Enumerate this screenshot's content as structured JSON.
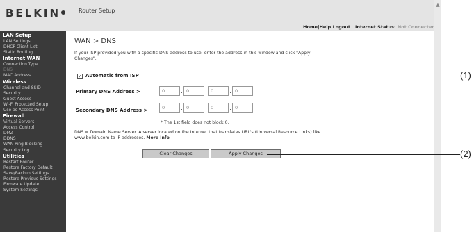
{
  "header": {
    "logo": "BELKIN",
    "app_title": "Router Setup",
    "links": [
      "Home",
      "Help",
      "Logout"
    ],
    "status_label": "Internet Status:",
    "status_value": "Not Connected"
  },
  "sidebar": [
    {
      "title": "LAN Setup",
      "items": [
        "LAN Settings",
        "DHCP Client List",
        "Static Routing"
      ]
    },
    {
      "title": "Internet WAN",
      "items": [
        "Connection Type",
        "DNS",
        "MAC Address"
      ]
    },
    {
      "title": "Wireless",
      "items": [
        "Channel and SSID",
        "Security",
        "Guest Access",
        "Wi-Fi Protected Setup",
        "Use as Access Point"
      ]
    },
    {
      "title": "Firewall",
      "items": [
        "Virtual Servers",
        "Access Control",
        "DMZ",
        "DDNS",
        "WAN Ping Blocking",
        "Security Log"
      ]
    },
    {
      "title": "Utilities",
      "items": [
        "Restart Router",
        "Restore Factory Default",
        "Save/Backup Settings",
        "Restore Previous Settings",
        "Firmware Update",
        "System Settings"
      ]
    }
  ],
  "main": {
    "breadcrumb": "WAN > DNS",
    "intro": "If your ISP provided you with a specific DNS address to use, enter the address in this window and click \"Apply Changes\".",
    "automatic_label": "Automatic from ISP",
    "automatic_checked": true,
    "primary_label": "Primary DNS Address >",
    "secondary_label": "Secondary DNS Address >",
    "primary_octets": [
      "0",
      "0",
      "0",
      "0"
    ],
    "secondary_octets": [
      "0",
      "0",
      "0",
      "0"
    ],
    "note": "* The 1st field does not block 0.",
    "dns_definition": "DNS = Domain Name Server. A server located on the Internet that translates URL's (Universal Resource Links) like www.belkin.com to IP addresses.",
    "more_info": "More Info",
    "clear_button": "Clear Changes",
    "apply_button": "Apply Changes"
  },
  "callouts": [
    "(1)",
    "(2)"
  ]
}
